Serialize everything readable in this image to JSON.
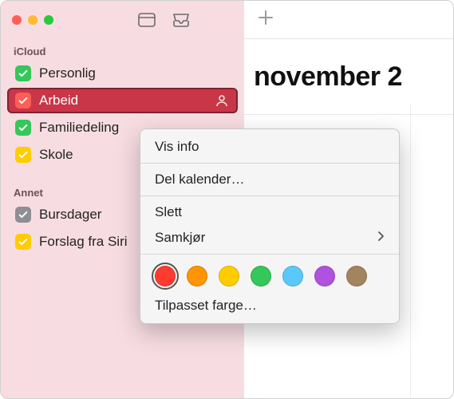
{
  "sidebar": {
    "sections": [
      {
        "title": "iCloud",
        "items": [
          {
            "label": "Personlig",
            "color": "#34c759"
          },
          {
            "label": "Arbeid",
            "color": "#ff3b30",
            "selected": true
          },
          {
            "label": "Familiedeling",
            "color": "#34c759"
          },
          {
            "label": "Skole",
            "color": "#ffcc00"
          }
        ]
      },
      {
        "title": "Annet",
        "items": [
          {
            "label": "Bursdager",
            "color": "#8e8e93"
          },
          {
            "label": "Forslag fra Siri",
            "color": "#ffcc00"
          }
        ]
      }
    ]
  },
  "main": {
    "month_title": "november 2"
  },
  "context_menu": {
    "show_info": "Vis info",
    "share_calendar": "Del kalender…",
    "delete": "Slett",
    "merge": "Samkjør",
    "custom_color": "Tilpasset farge…",
    "colors": [
      {
        "hex": "#ff3b30",
        "selected": true
      },
      {
        "hex": "#ff9500"
      },
      {
        "hex": "#ffcc00"
      },
      {
        "hex": "#34c759"
      },
      {
        "hex": "#5ac8fa"
      },
      {
        "hex": "#af52de"
      },
      {
        "hex": "#a2845e"
      }
    ]
  }
}
